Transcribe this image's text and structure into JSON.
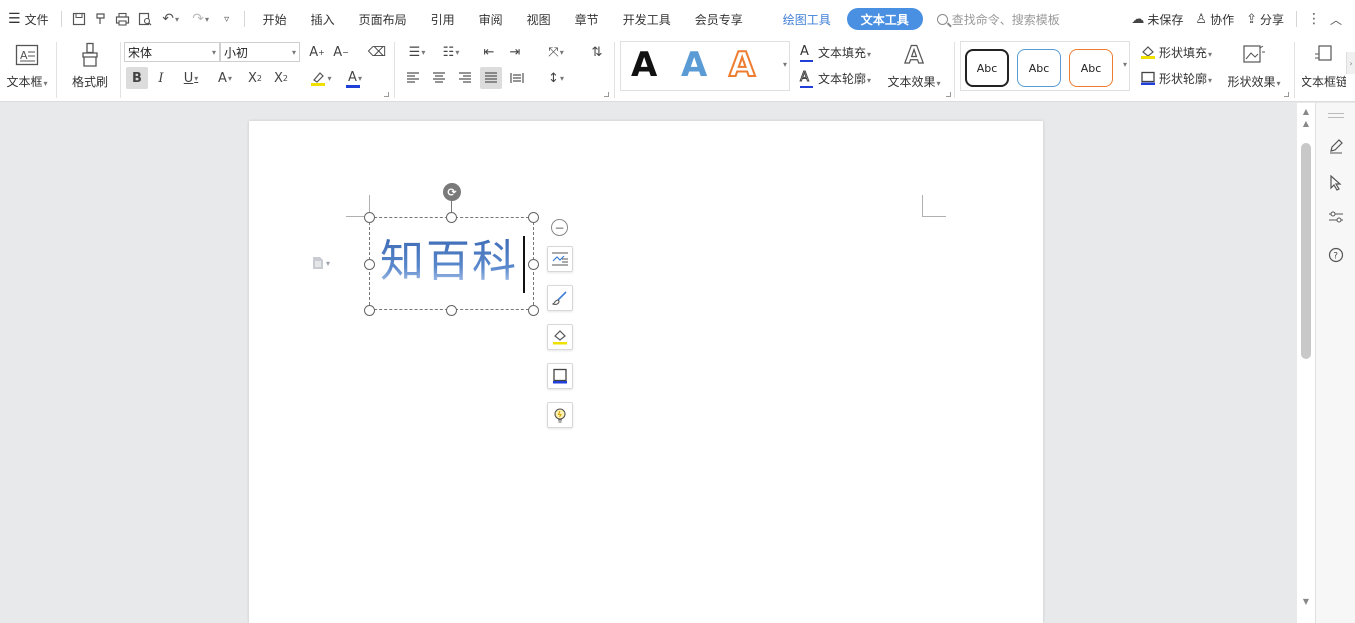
{
  "menubar": {
    "file_label": "文件",
    "tabs": [
      "开始",
      "插入",
      "页面布局",
      "引用",
      "审阅",
      "视图",
      "章节",
      "开发工具",
      "会员专享"
    ],
    "drawing_tools": "绘图工具",
    "text_tools": "文本工具",
    "search_placeholder": "查找命令、搜索模板",
    "unsaved": "未保存",
    "collaborate": "协作",
    "share": "分享"
  },
  "ribbon": {
    "textbox_label": "文本框",
    "format_painter": "格式刷",
    "font_name": "宋体",
    "font_size": "小初",
    "text_fill": "文本填充",
    "text_outline": "文本轮廓",
    "text_effect": "文本效果",
    "style_a": "A",
    "abc": "Abc",
    "shape_fill": "形状填充",
    "shape_outline": "形状轮廓",
    "shape_effect": "形状效果",
    "textbox_link": "文本框链"
  },
  "document": {
    "textbox_content": "知百科"
  },
  "colors": {
    "accent": "#4a90e2",
    "tab_blue": "#3f7fd6",
    "text_gradient_top": "#3d6bb5",
    "abc_black": "#222222",
    "abc_blue": "#5b9bd5",
    "abc_orange": "#ed7d31"
  }
}
